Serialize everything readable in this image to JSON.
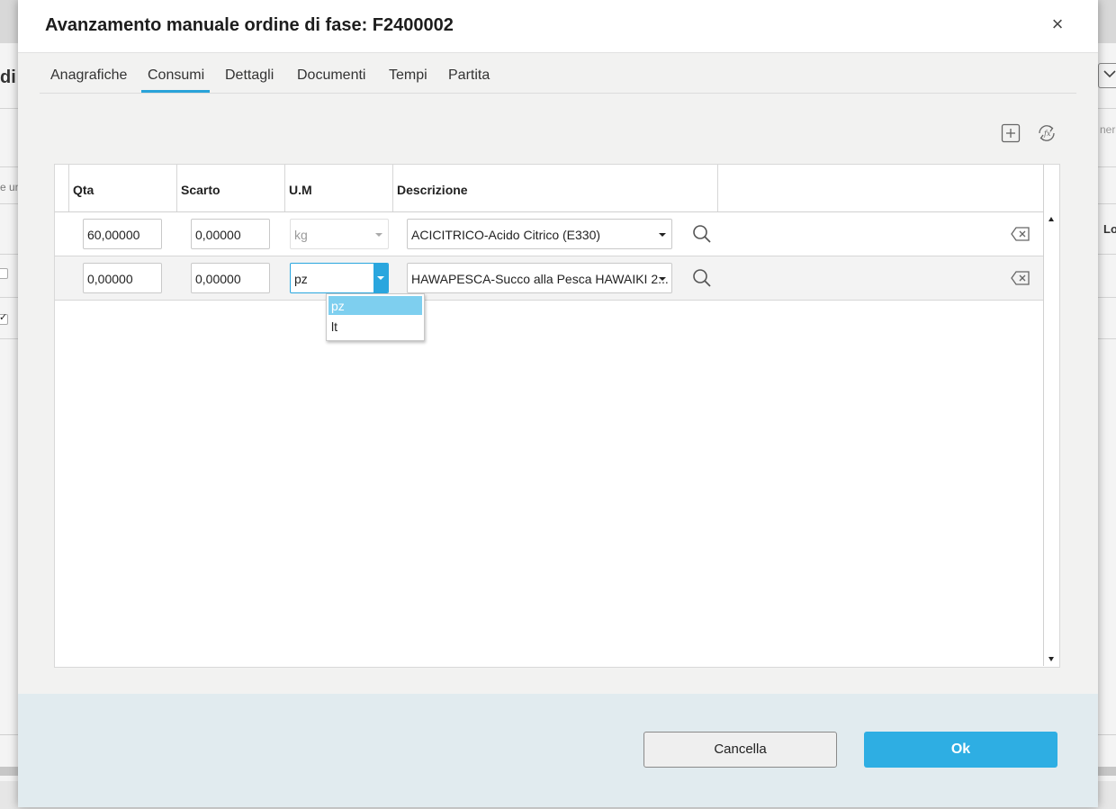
{
  "background": {
    "title_fragment": "di l",
    "left_text_fragment": "e un",
    "right_text_fragment": "ner",
    "right_header_fragment": "Lo"
  },
  "dialog": {
    "title": "Avanzamento manuale ordine di fase: F2400002",
    "close_label": "×",
    "tabs": [
      {
        "label": "Anagrafiche"
      },
      {
        "label": "Consumi",
        "active": true
      },
      {
        "label": "Dettagli"
      },
      {
        "label": "Documenti"
      },
      {
        "label": "Tempi"
      },
      {
        "label": "Partita"
      }
    ],
    "toolbar": {
      "add_icon": "add-square-icon",
      "refresh_icon": "formula-refresh-icon"
    },
    "grid": {
      "columns": [
        "Qta",
        "Scarto",
        "U.M",
        "Descrizione"
      ],
      "rows": [
        {
          "qta": "60,00000",
          "scarto": "0,00000",
          "um": "kg",
          "um_disabled": true,
          "descrizione": "ACICITRICO-Acido Citrico (E330)"
        },
        {
          "qta": "0,00000",
          "scarto": "0,00000",
          "um": "pz",
          "um_disabled": false,
          "descrizione": "HAWAPESCA-Succo alla Pesca HAWAIKI 2..."
        }
      ],
      "um_dropdown": {
        "options": [
          "pz",
          "lt"
        ],
        "selected": "pz"
      }
    },
    "footer": {
      "cancel_label": "Cancella",
      "ok_label": "Ok"
    },
    "colors": {
      "accent": "#2eaee3",
      "dropdown_selected": "#7ecfef",
      "footer_bg": "#e1ebef"
    }
  }
}
